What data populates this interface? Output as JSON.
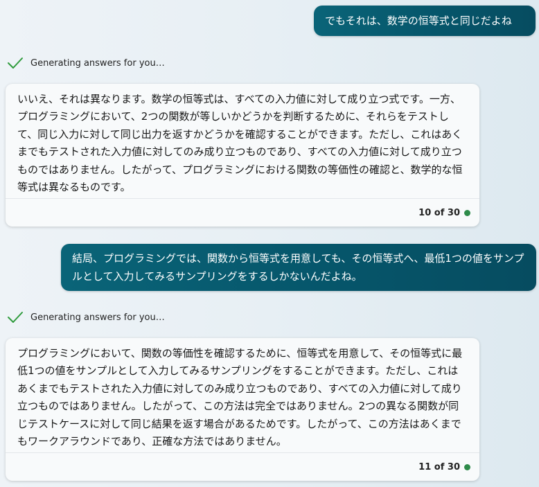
{
  "colors": {
    "user_bubble": "#06566b",
    "check": "#2e9b3c",
    "status_dot": "#2e8b4a",
    "card_bg": "#f8fafb"
  },
  "messages": [
    {
      "role": "user",
      "text": "でもそれは、数学の恒等式と同じだよね"
    },
    {
      "role": "assistant",
      "status": "Generating answers for you…",
      "status_icon": "checkmark-icon",
      "text": "いいえ、それは異なります。数学の恒等式は、すべての入力値に対して成り立つ式です。一方、プログラミングにおいて、2つの関数が等しいかどうかを判断するために、それらをテストして、同じ入力に対して同じ出力を返すかどうかを確認することができます。ただし、これはあくまでもテストされた入力値に対してのみ成り立つものであり、すべての入力値に対して成り立つものではありません。したがって、プログラミングにおける関数の等価性の確認と、数学的な恒等式は異なるものです。",
      "counter": "10 of 30"
    },
    {
      "role": "user",
      "text": "結局、プログラミングでは、関数から恒等式を用意しても、その恒等式へ、最低1つの値をサンプルとして入力してみるサンプリングをするしかないんだよね。"
    },
    {
      "role": "assistant",
      "status": "Generating answers for you…",
      "status_icon": "checkmark-icon",
      "text": "プログラミングにおいて、関数の等価性を確認するために、恒等式を用意して、その恒等式に最低1つの値をサンプルとして入力してみるサンプリングをすることができます。ただし、これはあくまでもテストされた入力値に対してのみ成り立つものであり、すべての入力値に対して成り立つものではありません。したがって、この方法は完全ではありません。2つの異なる関数が同じテストケースに対して同じ結果を返す場合があるためです。したがって、この方法はあくまでもワークアラウンドであり、正確な方法ではありません。",
      "counter": "11 of 30"
    }
  ]
}
